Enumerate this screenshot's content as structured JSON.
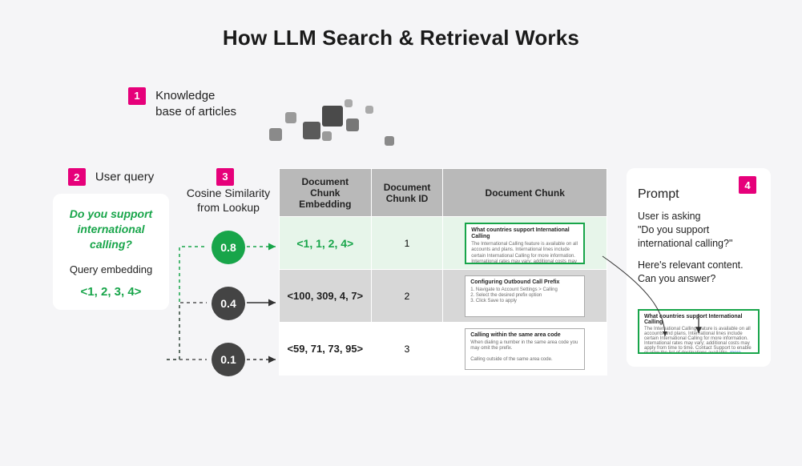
{
  "title": "How LLM Search & Retrieval Works",
  "steps": {
    "1": {
      "num": "1",
      "line1": "Knowledge",
      "line2": "base of articles"
    },
    "2": {
      "num": "2",
      "label": "User query"
    },
    "3": {
      "num": "3",
      "line1": "Cosine Similarity",
      "line2": "from Lookup"
    },
    "4": {
      "num": "4",
      "title": "Prompt"
    }
  },
  "user_query": {
    "question": "Do you support international calling?",
    "embedding_label": "Query embedding",
    "embedding": "<1, 2, 3, 4>"
  },
  "similarities": [
    "0.8",
    "0.4",
    "0.1"
  ],
  "table": {
    "headers": [
      "Document Chunk Embedding",
      "Document Chunk ID",
      "Document Chunk"
    ],
    "rows": [
      {
        "embedding": "<1, 1, 2, 4>",
        "id": "1",
        "variant": "green",
        "doc_title": "What countries support International Calling"
      },
      {
        "embedding": "<100, 309, 4, 7>",
        "id": "2",
        "variant": "grey",
        "doc_title": "Configuring Outbound Call Prefix"
      },
      {
        "embedding": "<59, 71, 73, 95>",
        "id": "3",
        "variant": "white",
        "doc_title": "Calling within the same area code"
      }
    ]
  },
  "prompt": {
    "line1": "User is asking",
    "line2": "\"Do you support international calling?\"",
    "line3": "Here's relevant content. Can you answer?",
    "doc_title": "What countries support International Calling"
  },
  "doc_filler": "The International Calling feature is available on all accounts and plans. International lines include certain International Calling for more information. International rates may vary; additional costs may apply from time to time. Contact Support to enable or view the list of destinations available."
}
